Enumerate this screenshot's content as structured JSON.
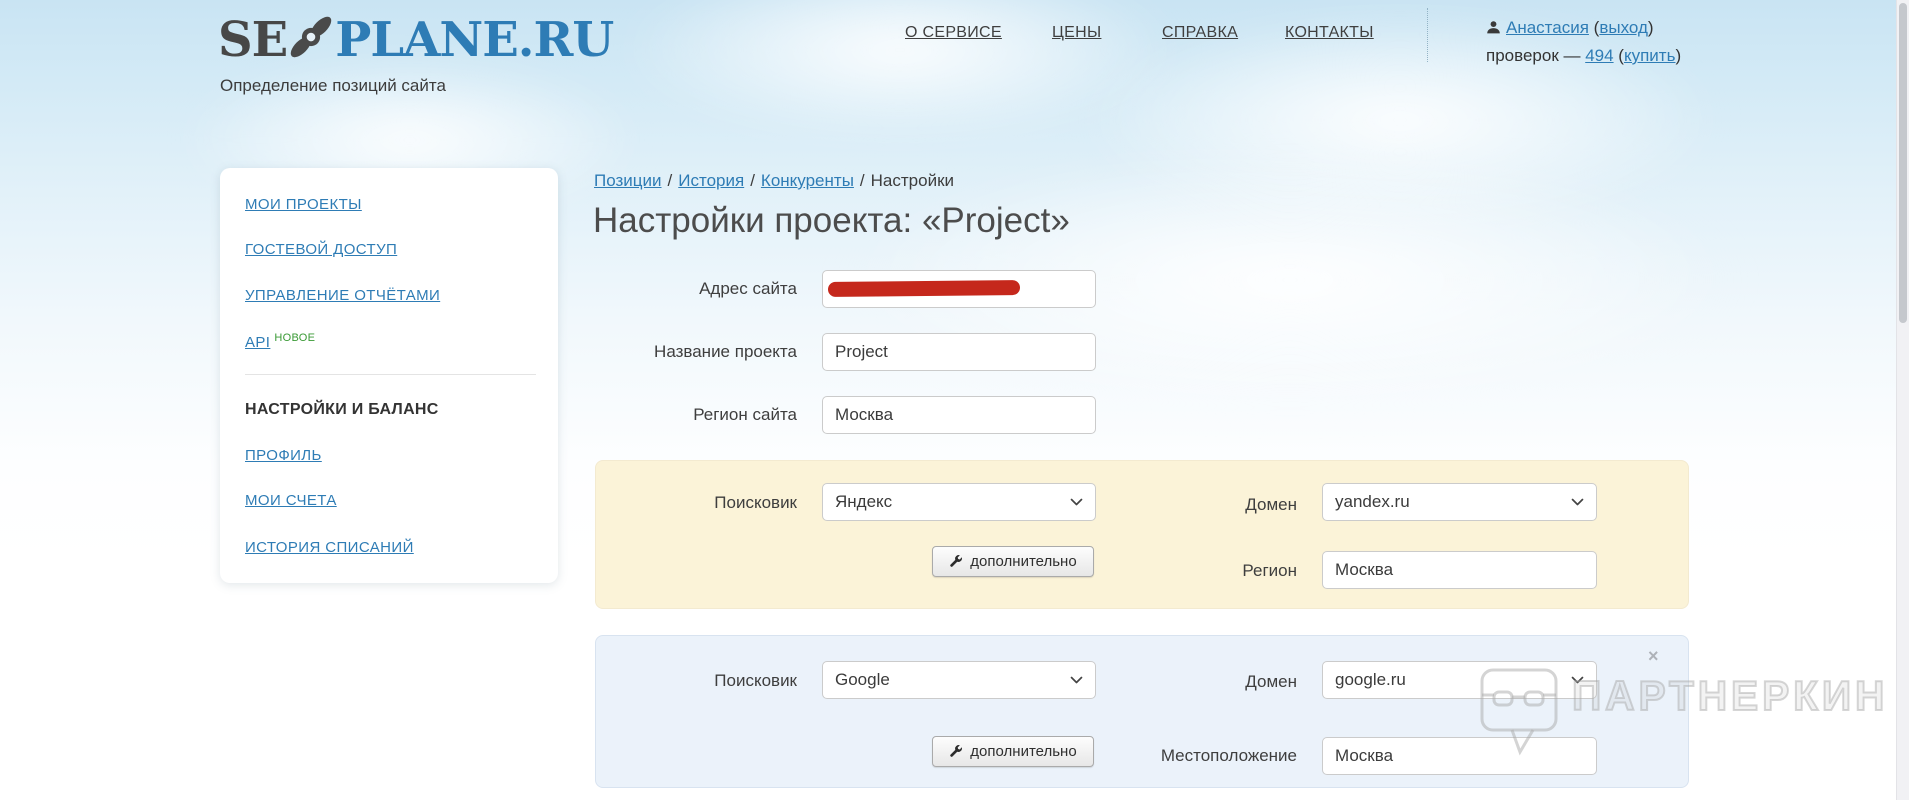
{
  "header": {
    "logo": {
      "se": "SE",
      "rest": "PLANE.RU",
      "tagline": "Определение позиций сайта"
    },
    "nav": [
      {
        "label": "О СЕРВИСЕ"
      },
      {
        "label": "ЦЕНЫ"
      },
      {
        "label": "СПРАВКА"
      },
      {
        "label": "КОНТАКТЫ"
      }
    ],
    "user": {
      "name": "Анастасия",
      "paren_open": "(",
      "logout": "выход",
      "paren_close": ")",
      "checks_label": "проверок — ",
      "checks_count": "494",
      "buy_open": " (",
      "buy": "купить",
      "buy_close": ")"
    }
  },
  "sidebar": {
    "items": [
      {
        "label": "МОИ ПРОЕКТЫ"
      },
      {
        "label": "ГОСТЕВОЙ ДОСТУП"
      },
      {
        "label": "УПРАВЛЕНИЕ ОТЧЁТАМИ"
      },
      {
        "label": "API",
        "badge": "НОВОЕ"
      }
    ],
    "section_heading": "НАСТРОЙКИ И БАЛАНС",
    "items2": [
      {
        "label": "ПРОФИЛЬ"
      },
      {
        "label": "МОИ СЧЕТА"
      },
      {
        "label": "ИСТОРИЯ СПИСАНИЙ"
      }
    ]
  },
  "breadcrumb": {
    "links": [
      {
        "label": "Позиции"
      },
      {
        "label": "История"
      },
      {
        "label": "Конкуренты"
      }
    ],
    "separator": "/",
    "current": "Настройки"
  },
  "main": {
    "title": "Настройки проекта: «Project»",
    "form": {
      "address_label": "Адрес сайта",
      "address_value": "",
      "name_label": "Название проекта",
      "name_value": "Project",
      "region_label": "Регион сайта",
      "region_value": "Москва"
    },
    "yandex_panel": {
      "engine_label": "Поисковик",
      "engine_value": "Яндекс",
      "extra_button": "дополнительно",
      "domain_label": "Домен",
      "domain_value": "yandex.ru",
      "region_label": "Регион",
      "region_value": "Москва"
    },
    "google_panel": {
      "engine_label": "Поисковик",
      "engine_value": "Google",
      "extra_button": "дополнительно",
      "domain_label": "Домен",
      "domain_value": "google.ru",
      "location_label": "Местоположение",
      "location_value": "Москва",
      "close": "×"
    }
  },
  "watermark": {
    "text": "ПАРТНЕРКИН"
  },
  "icons": {
    "propeller": "propeller-icon",
    "user": "person-silhouette-icon",
    "wrench": "wrench-icon",
    "chevron": "chevron-down-icon",
    "close": "close-icon"
  },
  "colors": {
    "link_blue": "#2e7cb5",
    "logo_dark": "#474747",
    "badge_green": "#3a9a35",
    "redaction_red": "#c5281c",
    "yandex_panel_bg": "#fbf3d8",
    "google_panel_bg": "#ebf2fa"
  }
}
